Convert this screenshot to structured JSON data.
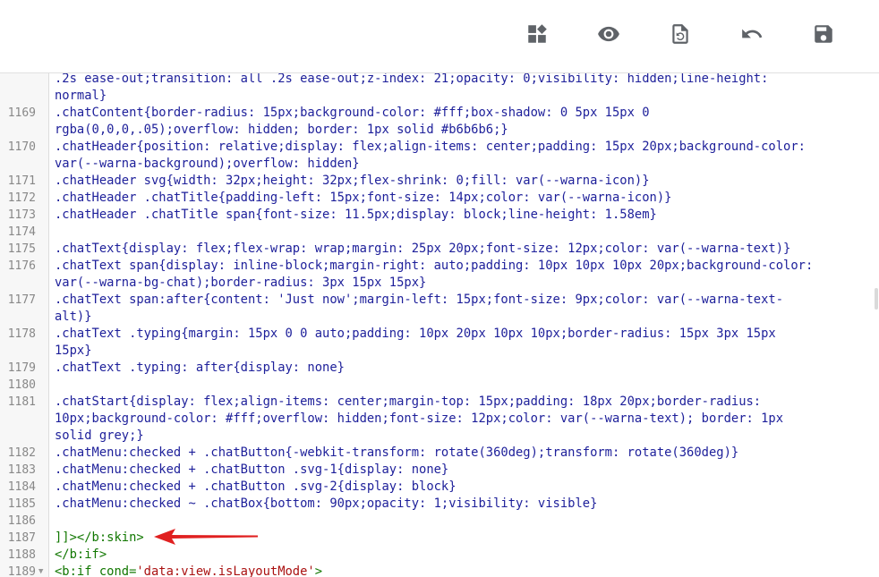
{
  "toolbar": {
    "buttons": [
      {
        "name": "layout-button",
        "icon": "layout-icon",
        "title": "Layout"
      },
      {
        "name": "preview-button",
        "icon": "eye-icon",
        "title": "Preview"
      },
      {
        "name": "restore-button",
        "icon": "restore-icon",
        "title": "Restore"
      },
      {
        "name": "undo-button",
        "icon": "undo-icon",
        "title": "Undo"
      },
      {
        "name": "save-button",
        "icon": "save-icon",
        "title": "Save"
      }
    ]
  },
  "editor": {
    "lines": [
      {
        "num": "",
        "text": ".2s ease-out;transition: all .2s ease-out;z-index: 21;opacity: 0;visibility: hidden;line-height:"
      },
      {
        "num": "",
        "text": "normal}"
      },
      {
        "num": "1169",
        "text": ".chatContent{border-radius: 15px;background-color: #fff;box-shadow: 0 5px 15px 0"
      },
      {
        "num": "",
        "text": "rgba(0,0,0,.05);overflow: hidden; border: 1px solid #b6b6b6;}"
      },
      {
        "num": "1170",
        "text": ".chatHeader{position: relative;display: flex;align-items: center;padding: 15px 20px;background-color:"
      },
      {
        "num": "",
        "text": "var(--warna-background);overflow: hidden}"
      },
      {
        "num": "1171",
        "text": ".chatHeader svg{width: 32px;height: 32px;flex-shrink: 0;fill: var(--warna-icon)}"
      },
      {
        "num": "1172",
        "text": ".chatHeader .chatTitle{padding-left: 15px;font-size: 14px;color: var(--warna-icon)}"
      },
      {
        "num": "1173",
        "text": ".chatHeader .chatTitle span{font-size: 11.5px;display: block;line-height: 1.58em}"
      },
      {
        "num": "1174",
        "text": ""
      },
      {
        "num": "1175",
        "text": ".chatText{display: flex;flex-wrap: wrap;margin: 25px 20px;font-size: 12px;color: var(--warna-text)}"
      },
      {
        "num": "1176",
        "text": ".chatText span{display: inline-block;margin-right: auto;padding: 10px 10px 10px 20px;background-color:"
      },
      {
        "num": "",
        "text": "var(--warna-bg-chat);border-radius: 3px 15px 15px}"
      },
      {
        "num": "1177",
        "text": ".chatText span:after{content: 'Just now';margin-left: 15px;font-size: 9px;color: var(--warna-text-"
      },
      {
        "num": "",
        "text": "alt)}"
      },
      {
        "num": "1178",
        "text": ".chatText .typing{margin: 15px 0 0 auto;padding: 10px 20px 10px 10px;border-radius: 15px 3px 15px"
      },
      {
        "num": "",
        "text": "15px}"
      },
      {
        "num": "1179",
        "text": ".chatText .typing: after{display: none}"
      },
      {
        "num": "1180",
        "text": ""
      },
      {
        "num": "1181",
        "text": ".chatStart{display: flex;align-items: center;margin-top: 15px;padding: 18px 20px;border-radius:"
      },
      {
        "num": "",
        "text": "10px;background-color: #fff;overflow: hidden;font-size: 12px;color: var(--warna-text); border: 1px"
      },
      {
        "num": "",
        "text": "solid grey;}"
      },
      {
        "num": "1182",
        "text": ".chatMenu:checked + .chatButton{-webkit-transform: rotate(360deg);transform: rotate(360deg)}"
      },
      {
        "num": "1183",
        "text": ".chatMenu:checked + .chatButton .svg-1{display: none}"
      },
      {
        "num": "1184",
        "text": ".chatMenu:checked + .chatButton .svg-2{display: block}"
      },
      {
        "num": "1185",
        "text": ".chatMenu:checked ~ .chatBox{bottom: 90px;opacity: 1;visibility: visible}"
      },
      {
        "num": "1186",
        "text": ""
      },
      {
        "num": "1187",
        "text": "]]></b:skin>",
        "tag": true
      },
      {
        "num": "1188",
        "text": "</b:if>",
        "tag": true
      },
      {
        "num": "1189",
        "fold": "▼",
        "pre": "<b:if cond=",
        "str": "'data:view.isLayoutMode'",
        "post": ">"
      }
    ]
  },
  "colors": {
    "code": "#1d1f9a",
    "tag": "#117700",
    "string": "#aa1111",
    "line_number": "#888888",
    "arrow": "#e02020",
    "icon": "#5f6368"
  }
}
